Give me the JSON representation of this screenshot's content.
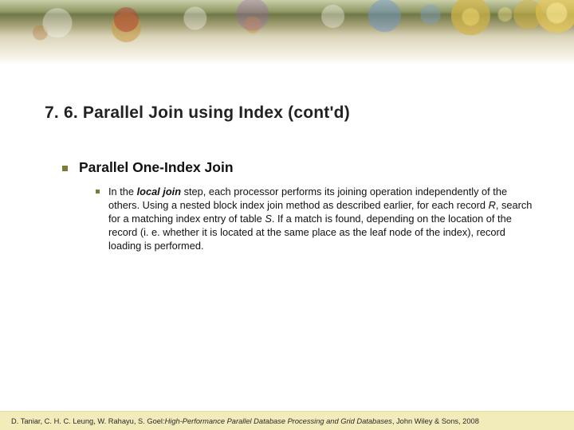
{
  "slide": {
    "title": "7. 6. Parallel Join using Index (cont'd)",
    "bullet1": "Parallel One-Index Join",
    "body_lead_italic": "local join",
    "body_pre": "In the ",
    "body_post_1": " step, each processor performs its joining operation independently of the others. Using a nested block index join method as described earlier, for each record ",
    "body_R": "R",
    "body_post_2": ", search for a matching index entry of table ",
    "body_S": "S",
    "body_post_3": ". If a match is found, depending on the location of the record (i. e. whether it is located at the same place as the leaf node of the index), record loading is performed."
  },
  "footer": {
    "authors": "D. Taniar, C. H. C. Leung, W. Rahayu, S. Goel: ",
    "book_title": "High-Performance Parallel Database Processing and Grid Databases",
    "publisher": ", John Wiley & Sons, 2008"
  }
}
